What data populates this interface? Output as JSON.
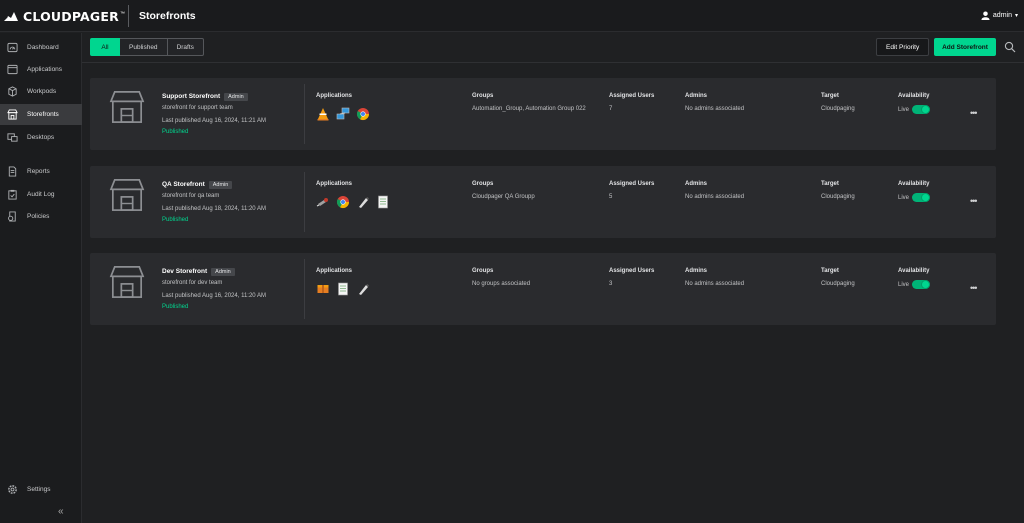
{
  "app": {
    "logo": "CLOUDPAGER",
    "title": "Storefronts",
    "user": "admin"
  },
  "sidebar": {
    "items": [
      {
        "label": "Dashboard",
        "icon": "dashboard-icon"
      },
      {
        "label": "Applications",
        "icon": "applications-icon"
      },
      {
        "label": "Workpods",
        "icon": "workpods-icon"
      },
      {
        "label": "Storefronts",
        "icon": "storefront-icon",
        "active": true
      },
      {
        "label": "Desktops",
        "icon": "desktops-icon"
      },
      {
        "label": "Reports",
        "icon": "reports-icon"
      },
      {
        "label": "Audit Log",
        "icon": "audit-log-icon"
      },
      {
        "label": "Policies",
        "icon": "policies-icon"
      }
    ],
    "settings": "Settings",
    "collapse": "«"
  },
  "toolbar": {
    "tabs": [
      "All",
      "Published",
      "Drafts"
    ],
    "active_tab": "All",
    "edit_priority": "Edit Priority",
    "add_storefront": "Add Storefront"
  },
  "columns": {
    "applications": "Applications",
    "groups": "Groups",
    "assigned_users": "Assigned Users",
    "admins": "Admins",
    "target": "Target",
    "availability": "Availability"
  },
  "storefronts": [
    {
      "name": "Support Storefront",
      "badge": "Admin",
      "description": "storefront for support team",
      "last_published": "Last published  Aug 16, 2024, 11:21 AM",
      "status": "Published",
      "apps": [
        "vlc-icon",
        "network-computers-icon",
        "chrome-icon"
      ],
      "groups": "Automation_Group, Automation Group 022",
      "assigned_users": "7",
      "admins": "No admins associated",
      "target": "Cloudpaging",
      "availability": "Live",
      "live": true
    },
    {
      "name": "QA Storefront",
      "badge": "Admin",
      "description": "storefront for qa team",
      "last_published": "Last published  Aug 18, 2024, 11:20 AM",
      "status": "Published",
      "apps": [
        "network-tool-icon",
        "chrome-icon",
        "pen-tool-icon",
        "notepad-icon"
      ],
      "groups": "Cloudpager QA Groupp",
      "assigned_users": "5",
      "admins": "No admins associated",
      "target": "Cloudpaging",
      "availability": "Live",
      "live": true
    },
    {
      "name": "Dev Storefront",
      "badge": "Admin",
      "description": "storefront for dev team",
      "last_published": "Last published  Aug 16, 2024, 11:20 AM",
      "status": "Published",
      "apps": [
        "package-icon",
        "notepad-icon",
        "pen-tool-icon"
      ],
      "groups": "No groups associated",
      "assigned_users": "3",
      "admins": "No admins associated",
      "target": "Cloudpaging",
      "availability": "Live",
      "live": true
    }
  ],
  "colors": {
    "accent": "#00d68f",
    "background": "#1f2022",
    "card": "#2a2b2e"
  }
}
